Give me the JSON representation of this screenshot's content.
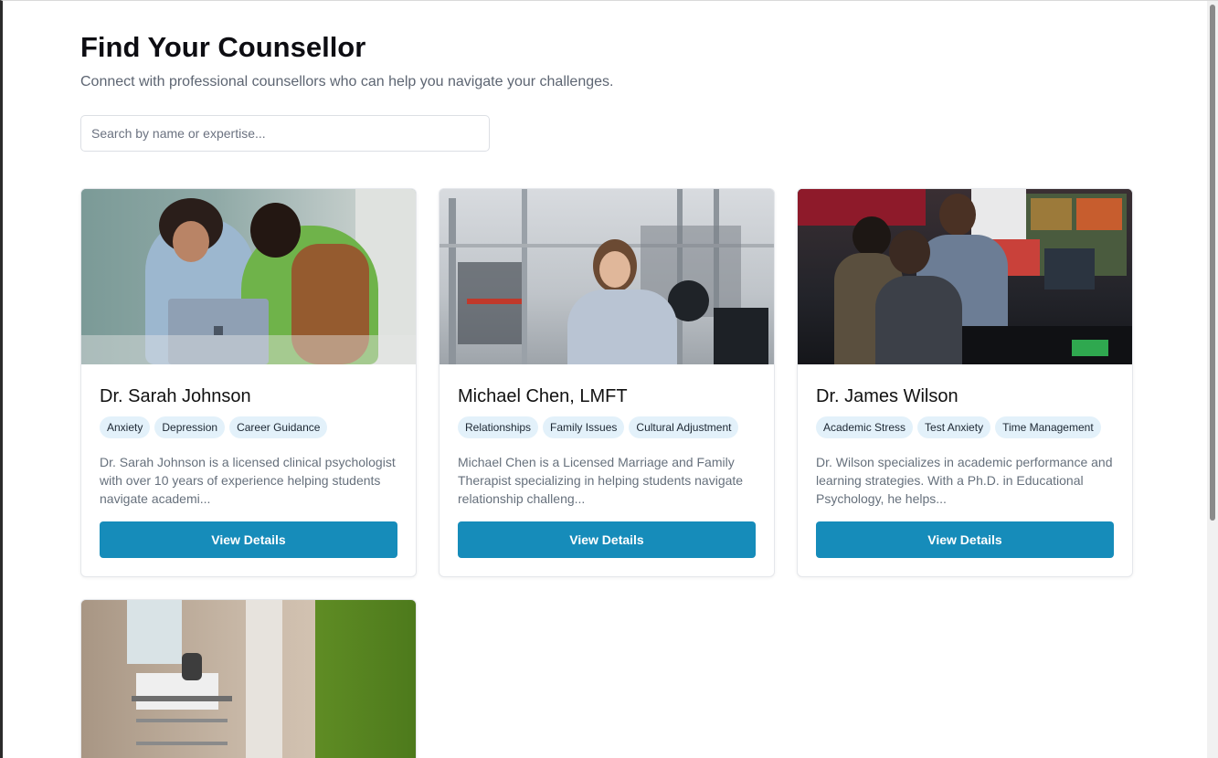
{
  "header": {
    "title": "Find Your Counsellor",
    "subtitle": "Connect with professional counsellors who can help you navigate your challenges."
  },
  "search": {
    "placeholder": "Search by name or expertise...",
    "value": ""
  },
  "counsellors": [
    {
      "name": "Dr. Sarah Johnson",
      "tags": [
        "Anxiety",
        "Depression",
        "Career Guidance"
      ],
      "description": "Dr. Sarah Johnson is a licensed clinical psychologist with over 10 years of experience helping students navigate academi...",
      "button_label": "View Details"
    },
    {
      "name": "Michael Chen, LMFT",
      "tags": [
        "Relationships",
        "Family Issues",
        "Cultural Adjustment"
      ],
      "description": "Michael Chen is a Licensed Marriage and Family Therapist specializing in helping students navigate relationship challeng...",
      "button_label": "View Details"
    },
    {
      "name": "Dr. James Wilson",
      "tags": [
        "Academic Stress",
        "Test Anxiety",
        "Time Management"
      ],
      "description": "Dr. Wilson specializes in academic performance and learning strategies. With a Ph.D. in Educational Psychology, he helps...",
      "button_label": "View Details"
    }
  ],
  "colors": {
    "accent": "#168cba",
    "tag_bg": "#e3f1fa"
  }
}
